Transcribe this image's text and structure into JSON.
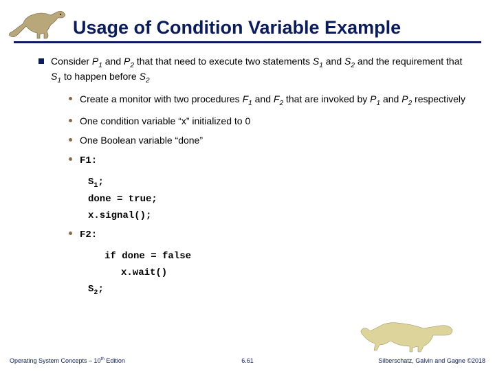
{
  "title": "Usage of Condition Variable  Example",
  "main_bullet": "Consider <em>P<sub>1</sub></em> and <em>P<sub>2</sub></em> that that need to execute two statements <em>S<sub>1</sub></em> and <em>S<sub>2</sub></em> and the requirement  that <em>S<sub>1</sub></em> to happen before <em>S<sub>2</sub></em>",
  "sub_bullets": {
    "b1": "Create a monitor with two procedures <em>F<sub>1</sub></em> and <em>F<sub>2</sub></em> that are invoked by <em>P<sub>1</sub></em> and <em>P<sub>2</sub></em> respectively",
    "b2": "One condition variable “x” initialized to 0",
    "b3": "One Boolean variable “done”",
    "b4": "F1:",
    "b5": "F2:"
  },
  "code1": {
    "l1": "S<sub>1</sub>;",
    "l2": "done = true;",
    "l3": "x.signal();"
  },
  "code2": {
    "l1": "if done = false",
    "l2": "x.wait()",
    "l3": "S<sub>2</sub>;"
  },
  "footer": {
    "left": "Operating System Concepts – 10<sup>th</sup> Edition",
    "center": "6.61",
    "right": "Silberschatz, Galvin and Gagne ©2018"
  }
}
